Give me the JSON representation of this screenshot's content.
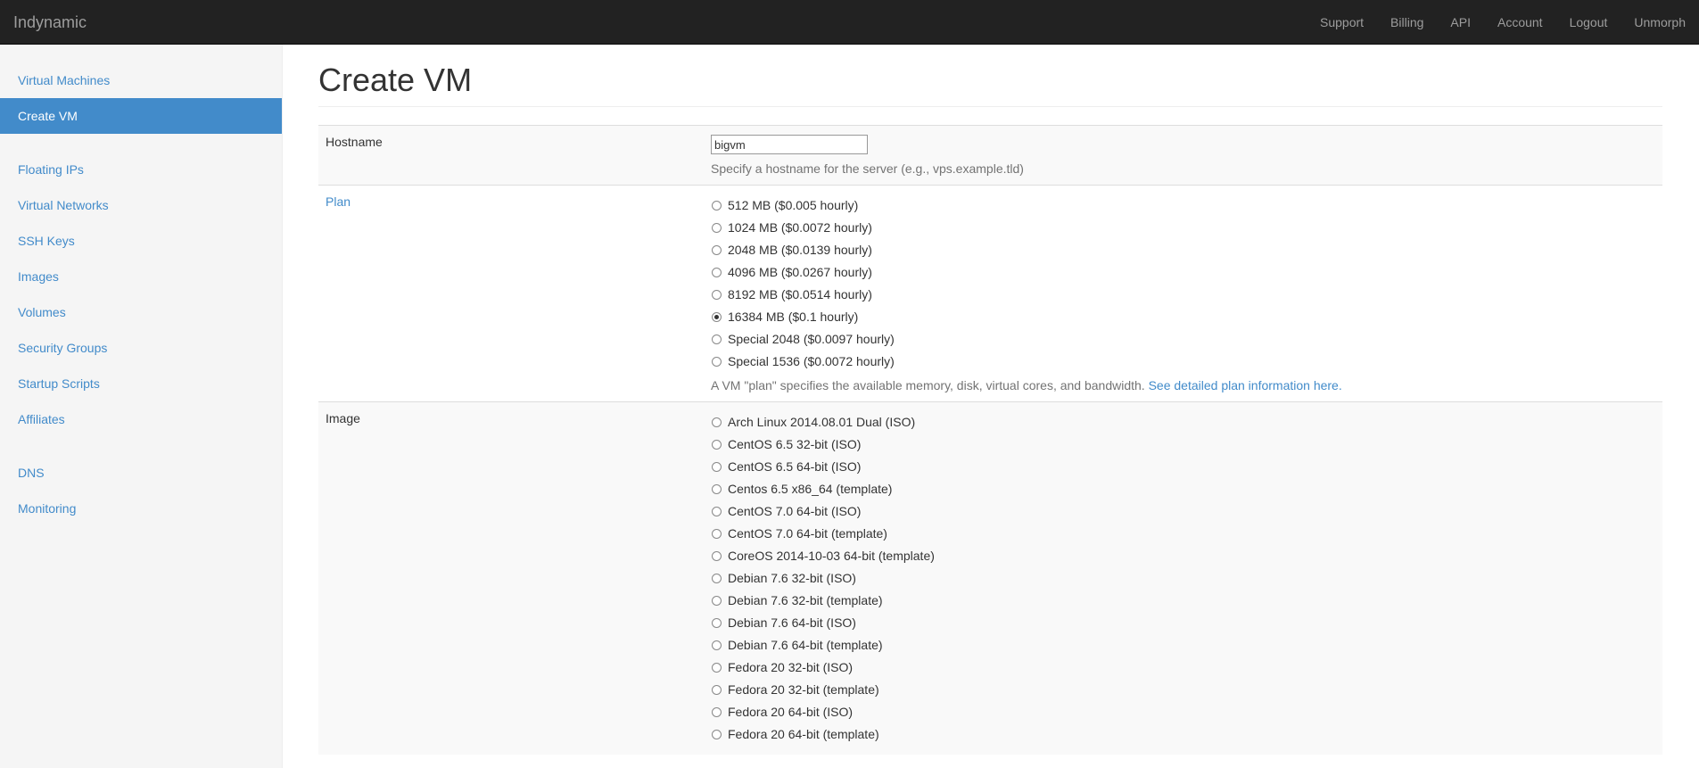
{
  "brand": "Indynamic",
  "topnav": [
    "Support",
    "Billing",
    "API",
    "Account",
    "Logout",
    "Unmorph"
  ],
  "sidebar": {
    "group1": [
      "Virtual Machines",
      "Create VM"
    ],
    "group2": [
      "Floating IPs",
      "Virtual Networks",
      "SSH Keys",
      "Images",
      "Volumes",
      "Security Groups",
      "Startup Scripts",
      "Affiliates"
    ],
    "group3": [
      "DNS",
      "Monitoring"
    ],
    "active": "Create VM"
  },
  "page": {
    "title": "Create VM"
  },
  "hostname": {
    "label": "Hostname",
    "value": "bigvm",
    "help": "Specify a hostname for the server (e.g., vps.example.tld)"
  },
  "plan": {
    "label": "Plan",
    "options": [
      "512 MB ($0.005 hourly)",
      "1024 MB ($0.0072 hourly)",
      "2048 MB ($0.0139 hourly)",
      "4096 MB ($0.0267 hourly)",
      "8192 MB ($0.0514 hourly)",
      "16384 MB ($0.1 hourly)",
      "Special 2048 ($0.0097 hourly)",
      "Special 1536 ($0.0072 hourly)"
    ],
    "selected_index": 5,
    "help": "A VM \"plan\" specifies the available memory, disk, virtual cores, and bandwidth.",
    "help_link": "See detailed plan information here."
  },
  "image": {
    "label": "Image",
    "options": [
      "Arch Linux 2014.08.01 Dual (ISO)",
      "CentOS 6.5 32-bit (ISO)",
      "CentOS 6.5 64-bit (ISO)",
      "Centos 6.5 x86_64 (template)",
      "CentOS 7.0 64-bit (ISO)",
      "CentOS 7.0 64-bit (template)",
      "CoreOS 2014-10-03 64-bit (template)",
      "Debian 7.6 32-bit (ISO)",
      "Debian 7.6 32-bit (template)",
      "Debian 7.6 64-bit (ISO)",
      "Debian 7.6 64-bit (template)",
      "Fedora 20 32-bit (ISO)",
      "Fedora 20 32-bit (template)",
      "Fedora 20 64-bit (ISO)",
      "Fedora 20 64-bit (template)"
    ]
  }
}
